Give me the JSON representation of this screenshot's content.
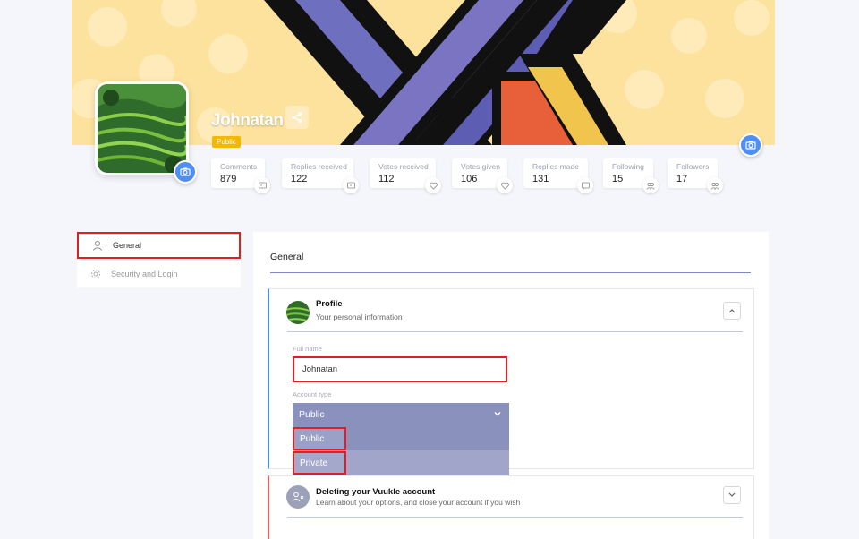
{
  "profile": {
    "username": "Johnatan",
    "visibility_badge": "Public"
  },
  "stats": [
    {
      "label": "Comments",
      "value": "879",
      "icon": "reply-icon"
    },
    {
      "label": "Replies received",
      "value": "122",
      "icon": "reply-in-icon"
    },
    {
      "label": "Votes received",
      "value": "112",
      "icon": "heart-in-icon"
    },
    {
      "label": "Votes given",
      "value": "106",
      "icon": "heart-out-icon"
    },
    {
      "label": "Replies made",
      "value": "131",
      "icon": "chat-icon"
    },
    {
      "label": "Following",
      "value": "15",
      "icon": "users-icon"
    },
    {
      "label": "Followers",
      "value": "17",
      "icon": "users-icon"
    }
  ],
  "sidebar": {
    "items": [
      {
        "label": "General",
        "icon": "user-icon"
      },
      {
        "label": "Security and Login",
        "icon": "gear-icon"
      }
    ]
  },
  "main": {
    "title": "General",
    "profile_card": {
      "title": "Profile",
      "subtitle": "Your personal information",
      "full_name_label": "Full name",
      "full_name_value": "Johnatan",
      "account_type_label": "Account type",
      "account_type_value": "Public",
      "account_type_options": [
        "Public",
        "Private"
      ]
    },
    "delete_card": {
      "title": "Deleting your Vuukle account",
      "subtitle": "Learn about your options, and close your account if you wish"
    }
  },
  "colors": {
    "accent_blue": "#4f8ef7",
    "badge_yellow": "#f5b800",
    "select_bg": "#8a91bd",
    "highlight_red": "#e02020",
    "delete_red": "#ef5b5b"
  }
}
